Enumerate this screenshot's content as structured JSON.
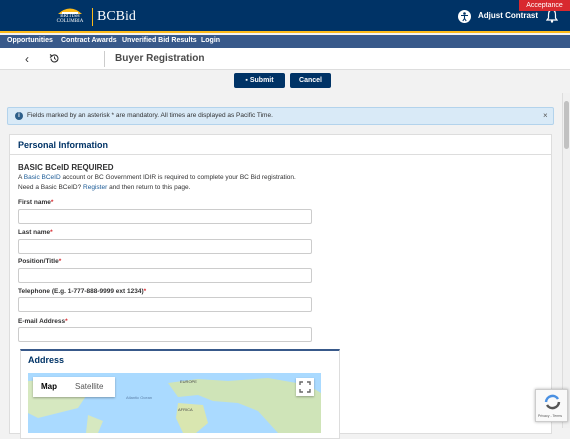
{
  "header": {
    "logo_text": "BRITISH COLUMBIA",
    "brand": "BCBid",
    "accessibility_label": "Adjust Contrast",
    "environment_badge": "Acceptance"
  },
  "nav": {
    "items": [
      {
        "label": "Opportunities"
      },
      {
        "label": "Contract Awards"
      },
      {
        "label": "Unverified Bid Results"
      },
      {
        "label": "Login"
      }
    ]
  },
  "subbar": {
    "back_icon": "‹",
    "page_title": "Buyer Registration"
  },
  "actions": {
    "submit_label": "Submit",
    "cancel_label": "Cancel"
  },
  "info": {
    "text": "Fields marked by an asterisk * are mandatory. All times are displayed as Pacific Time.",
    "icon": "i",
    "close": "×"
  },
  "personal": {
    "title": "Personal Information",
    "heading": "BASIC BCeID REQUIRED",
    "line1_prefix": "A ",
    "line1_link": "Basic BCeID",
    "line1_suffix": " account or BC Government IDIR is required to complete your BC Bid registration.",
    "line2_prefix": "Need a Basic BCeID? ",
    "line2_link": "Register",
    "line2_suffix": " and then return to this page.",
    "fields": [
      {
        "label": "First name",
        "value": ""
      },
      {
        "label": "Last name",
        "value": ""
      },
      {
        "label": "Position/Title",
        "value": ""
      },
      {
        "label": "Telephone (E.g. 1-777-888-9999 ext 1234)",
        "value": ""
      },
      {
        "label": "E-mail Address",
        "value": ""
      }
    ],
    "required_mark": "*"
  },
  "address": {
    "title": "Address",
    "map_tab_map": "Map",
    "map_tab_satellite": "Satellite",
    "map_labels": {
      "europe": "EUROPE",
      "africa": "AFRICA",
      "ocean": "Atlantic Ocean"
    }
  },
  "captcha": {
    "text": "Privacy - Terms"
  },
  "colors": {
    "brand_navy": "#003366",
    "nav_blue": "#38598a",
    "gold": "#fcba19",
    "badge_red": "#d8292f"
  }
}
